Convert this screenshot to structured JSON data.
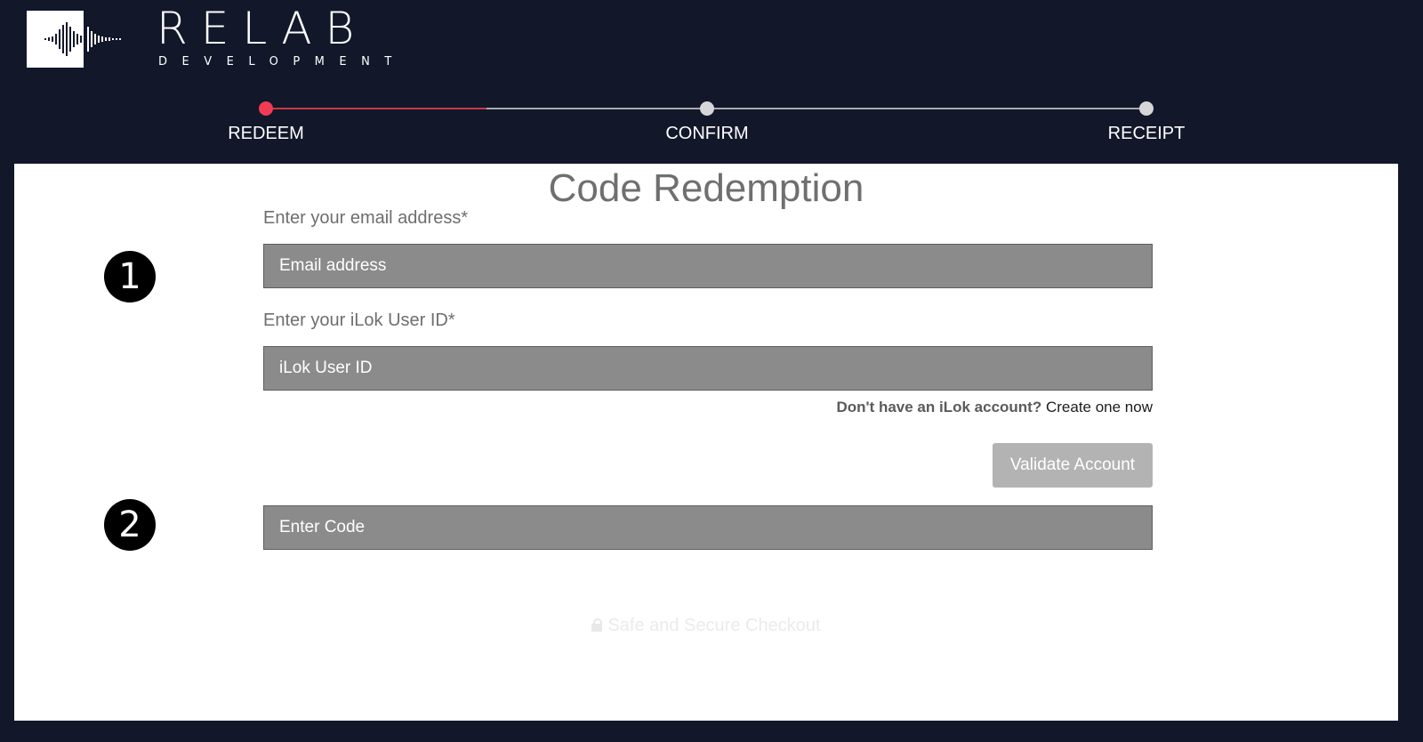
{
  "brand": {
    "name": "RELAB",
    "subtitle": "DEVELOPMENT"
  },
  "steps": [
    {
      "label": "REDEEM",
      "active": true
    },
    {
      "label": "CONFIRM",
      "active": false
    },
    {
      "label": "RECEIPT",
      "active": false
    }
  ],
  "form": {
    "title": "Code Redemption",
    "email_label": "Enter your email address*",
    "email_placeholder": "Email address",
    "ilok_label": "Enter your iLok User ID*",
    "ilok_placeholder": "iLok User ID",
    "account_question": "Don't have an iLok account?",
    "account_link": "Create one now",
    "validate_button": "Validate Account",
    "code_placeholder": "Enter Code",
    "badge_1": "1",
    "badge_2": "2"
  },
  "footer": {
    "secure_text": "Safe and Secure Checkout"
  },
  "colors": {
    "background": "#12172a",
    "active_step": "#ef3c54",
    "input_fill": "#8a8b8a"
  }
}
